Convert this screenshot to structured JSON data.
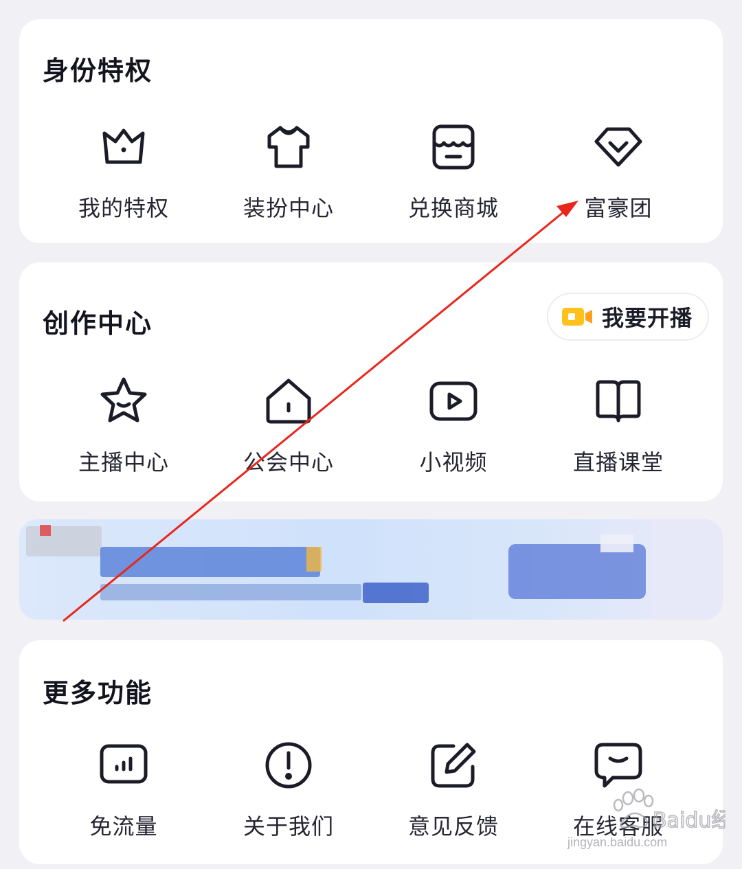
{
  "sections": {
    "privileges": {
      "title": "身份特权",
      "items": [
        {
          "label": "我的特权",
          "icon": "crown-icon"
        },
        {
          "label": "装扮中心",
          "icon": "tshirt-icon"
        },
        {
          "label": "兑换商城",
          "icon": "store-icon"
        },
        {
          "label": "富豪团",
          "icon": "diamond-icon"
        }
      ]
    },
    "creation": {
      "title": "创作中心",
      "live_button": "我要开播",
      "items": [
        {
          "label": "主播中心",
          "icon": "star-face-icon"
        },
        {
          "label": "公会中心",
          "icon": "house-icon"
        },
        {
          "label": "小视频",
          "icon": "play-video-icon"
        },
        {
          "label": "直播课堂",
          "icon": "book-icon"
        }
      ]
    },
    "more": {
      "title": "更多功能",
      "items": [
        {
          "label": "免流量",
          "icon": "signal-bars-icon"
        },
        {
          "label": "关于我们",
          "icon": "info-exclamation-icon"
        },
        {
          "label": "意见反馈",
          "icon": "edit-pencil-icon"
        },
        {
          "label": "在线客服",
          "icon": "chat-bubble-icon"
        }
      ]
    }
  },
  "watermark": {
    "brand": "Baidu经验",
    "url": "jingyan.baidu.com"
  },
  "colors": {
    "icon_stroke": "#1c1c28",
    "live_icon": "#ffc21a",
    "arrow": "#e8261c",
    "background": "#f1f1f5"
  }
}
